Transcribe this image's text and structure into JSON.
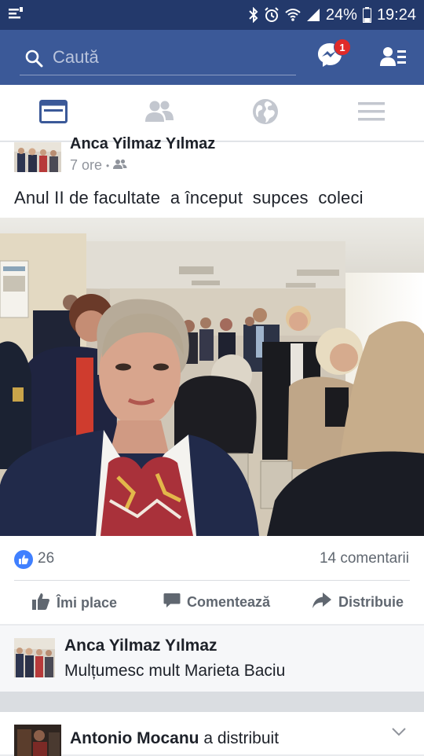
{
  "status_bar": {
    "battery": "24%",
    "time": "19:24"
  },
  "search": {
    "placeholder": "Caută"
  },
  "header": {
    "messenger_badge": "1"
  },
  "tabs": [
    {
      "icon": "news-feed-icon",
      "active": true
    },
    {
      "icon": "friends-icon",
      "active": false
    },
    {
      "icon": "globe-icon",
      "active": false
    },
    {
      "icon": "menu-icon",
      "active": false
    }
  ],
  "post": {
    "author": "Anca Yilmaz Yılmaz",
    "time": "7 ore",
    "separator": "•",
    "text": "Anul II de facultate  a început  supces  coleci",
    "likes": "26",
    "comments": "14 comentarii",
    "actions": {
      "like": "Îmi place",
      "comment": "Comentează",
      "share": "Distribuie"
    }
  },
  "comment": {
    "author": "Anca Yilmaz Yılmaz",
    "text": "Mulțumesc mult Marieta Baciu"
  },
  "next_post": {
    "author": "Antonio Mocanu",
    "action": " a distribuit"
  },
  "colors": {
    "brand": "#3b5998",
    "status_bar": "#23396b",
    "like_blue": "#4080ff"
  }
}
